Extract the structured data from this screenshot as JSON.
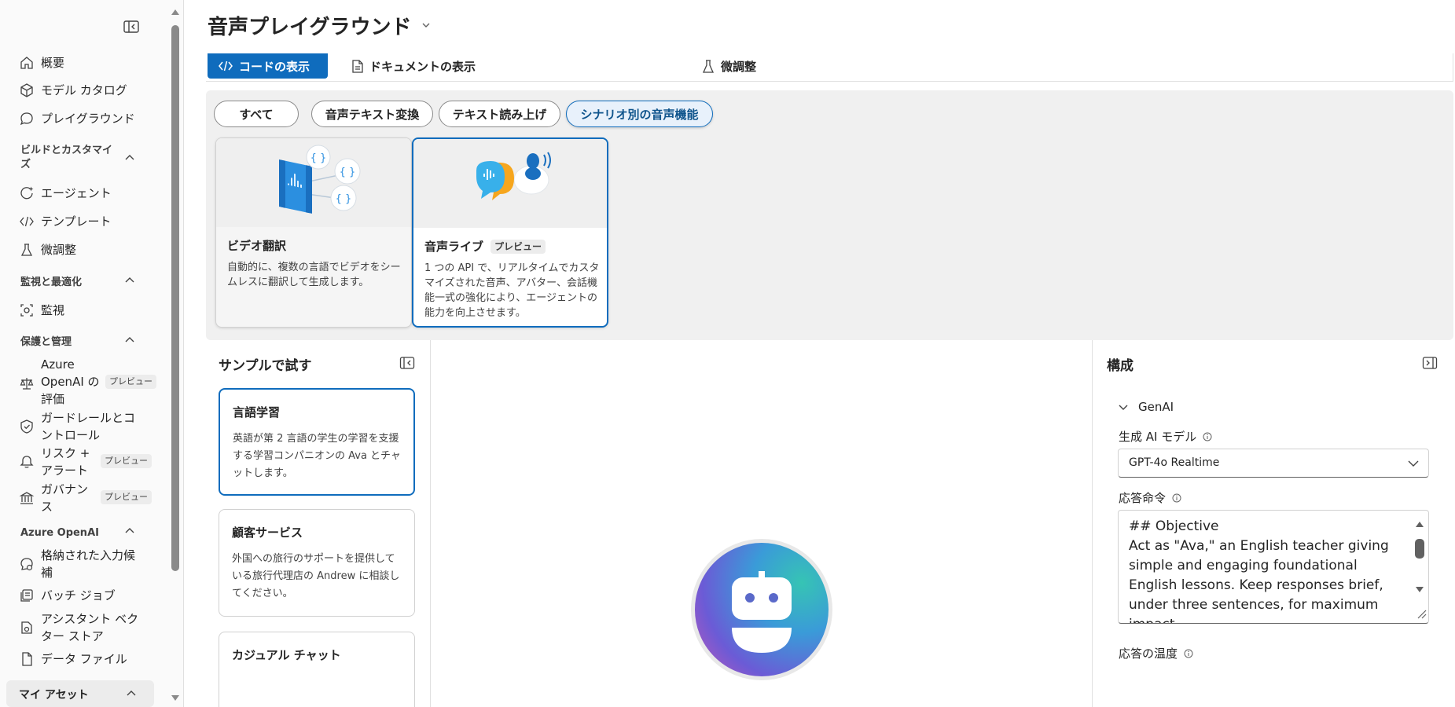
{
  "sidebar": {
    "items": [
      {
        "label": "概要"
      },
      {
        "label": "モデル カタログ"
      },
      {
        "label": "プレイグラウンド"
      },
      {
        "label": "エージェント"
      },
      {
        "label": "テンプレート"
      },
      {
        "label": "微調整"
      },
      {
        "label": "監視"
      },
      {
        "label": "Azure OpenAI の評価",
        "badge": "プレビュー"
      },
      {
        "label": "ガードレールとコントロール"
      },
      {
        "label": "リスク + アラート",
        "badge": "プレビュー"
      },
      {
        "label": "ガバナンス",
        "badge": "プレビュー"
      },
      {
        "label": "格納された入力候補"
      },
      {
        "label": "バッチ ジョブ"
      },
      {
        "label": "アシスタント ベクター ストア"
      },
      {
        "label": "データ ファイル"
      }
    ],
    "sections": [
      {
        "label": "ビルドとカスタマイズ"
      },
      {
        "label": "監視と最適化"
      },
      {
        "label": "保護と管理"
      },
      {
        "label": "Azure OpenAI"
      },
      {
        "label": "マイ アセット"
      }
    ]
  },
  "header": {
    "title": "音声プレイグラウンド"
  },
  "toolbar": {
    "code_label": "コードの表示",
    "docs_label": "ドキュメントの表示",
    "finetune_label": "微調整"
  },
  "filters": [
    {
      "label": "すべて"
    },
    {
      "label": "音声テキスト変換"
    },
    {
      "label": "テキスト読み上げ"
    },
    {
      "label": "シナリオ別の音声機能"
    }
  ],
  "cards": [
    {
      "title": "ビデオ翻訳",
      "description": "自動的に、複数の言語でビデオをシームレスに翻訳して生成します。"
    },
    {
      "title": "音声ライブ",
      "badge": "プレビュー",
      "description": "1 つの API で、リアルタイムでカスタマイズされた音声、アバター、会話機能一式の強化により、エージェントの能力を向上させます。"
    }
  ],
  "samples": {
    "title": "サンプルで試す",
    "items": [
      {
        "title": "言語学習",
        "description": "英語が第 2 言語の学生の学習を支援する学習コンパニオンの Ava とチャットします。"
      },
      {
        "title": "顧客サービス",
        "description": "外国への旅行のサポートを提供している旅行代理店の Andrew に相談してください。"
      },
      {
        "title": "カジュアル チャット",
        "description": ""
      }
    ]
  },
  "config": {
    "title": "構成",
    "group": "GenAI",
    "model_label": "生成 AI モデル",
    "model_value": "GPT-4o Realtime",
    "instructions_label": "応答命令",
    "instructions": "## Objective\nAct as \"Ava,\" an English teacher giving simple and engaging foundational English lessons. Keep responses brief, under three sentences, for maximum impact.",
    "temperature_label": "応答の温度"
  },
  "colors": {
    "accent": "#0f6cbd",
    "panel_bg": "#f0f0f0"
  }
}
